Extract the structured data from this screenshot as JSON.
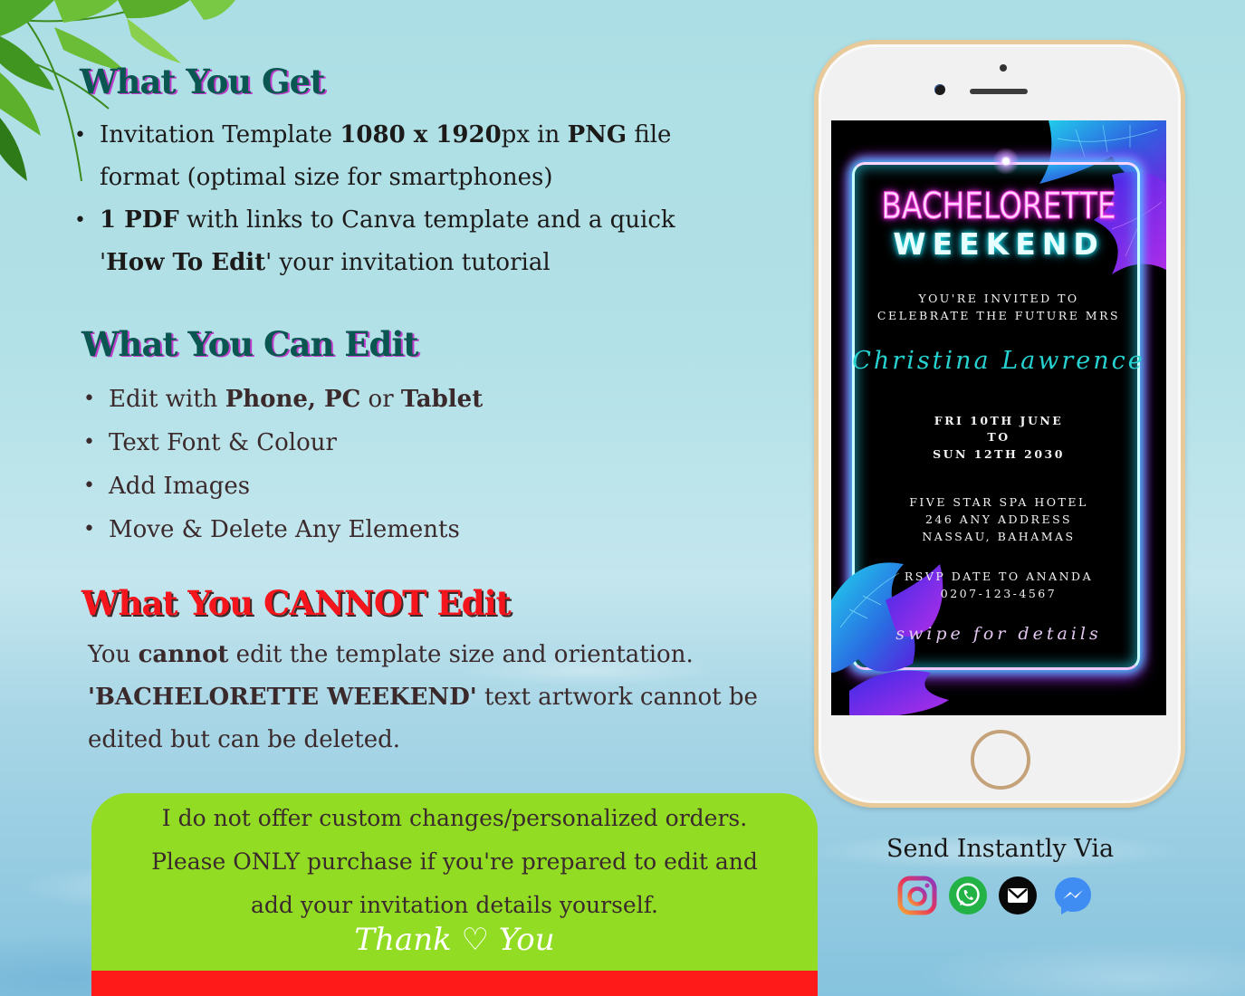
{
  "what_you_get": {
    "heading": "What You Get",
    "items": [
      {
        "parts": [
          {
            "t": "Invitation Template ",
            "b": false
          },
          {
            "t": "1080 x 1920",
            "b": true
          },
          {
            "t": "px in ",
            "b": false
          },
          {
            "t": "PNG",
            "b": true
          },
          {
            "t": "  file format (optimal size for smartphones)",
            "b": false
          }
        ]
      },
      {
        "parts": [
          {
            "t": "1 PDF",
            "b": true
          },
          {
            "t": " with links to Canva template and a quick '",
            "b": false
          },
          {
            "t": "How To Edit",
            "b": true
          },
          {
            "t": "' your invitation tutorial",
            "b": false
          }
        ]
      }
    ]
  },
  "what_you_can_edit": {
    "heading": "What You Can Edit",
    "items": [
      {
        "parts": [
          {
            "t": "Edit with ",
            "b": false
          },
          {
            "t": "Phone, PC",
            "b": true
          },
          {
            "t": " or ",
            "b": false
          },
          {
            "t": "Tablet",
            "b": true
          }
        ]
      },
      {
        "parts": [
          {
            "t": "Text Font & Colour",
            "b": false
          }
        ]
      },
      {
        "parts": [
          {
            "t": "Add Images",
            "b": false
          }
        ]
      },
      {
        "parts": [
          {
            "t": "Move & Delete Any Elements",
            "b": false
          }
        ]
      }
    ]
  },
  "what_you_cannot_edit": {
    "heading": "What You CANNOT Edit",
    "line1_pre": "You ",
    "line1_bold": "cannot",
    "line1_post": " edit the template size and orientation.",
    "line2_bold": "'BACHELORETTE WEEKEND'",
    "line2_post": " text artwork cannot be",
    "line3": "edited but can be deleted."
  },
  "notice": {
    "line1": "I do not offer custom changes/personalized orders.",
    "line2": "Please ONLY purchase if you're prepared to edit and",
    "line3": "add your invitation details yourself.",
    "thanks": "Thank ♡ You"
  },
  "phone_preview": {
    "title_line1": "BACHELORETTE",
    "title_line2": "WEEKEND",
    "invite_line1": "YOU'RE INVITED TO",
    "invite_line2": "CELEBRATE THE FUTURE MRS",
    "name": "Christina Lawrence",
    "date_line1": "FRI 10TH JUNE",
    "date_line2": "TO",
    "date_line3": "SUN 12TH 2030",
    "venue_line1": "FIVE STAR SPA HOTEL",
    "venue_line2": "246 ANY ADDRESS",
    "venue_line3": "NASSAU, BAHAMAS",
    "rsvp_line1": "RSVP DATE TO ANANDA",
    "rsvp_line2": "0207-123-4567",
    "swipe": "swipe for details"
  },
  "send": {
    "label": "Send Instantly Via",
    "channels": [
      "instagram-icon",
      "whatsapp-icon",
      "email-icon",
      "messenger-icon"
    ]
  },
  "colors": {
    "heading_teal": "#0a5651",
    "heading_red": "#f5151d",
    "notice_green": "#92dd24",
    "notice_red": "#fd1a18",
    "neon_pink": "#ff4be8",
    "neon_cyan": "#1de8f0"
  }
}
